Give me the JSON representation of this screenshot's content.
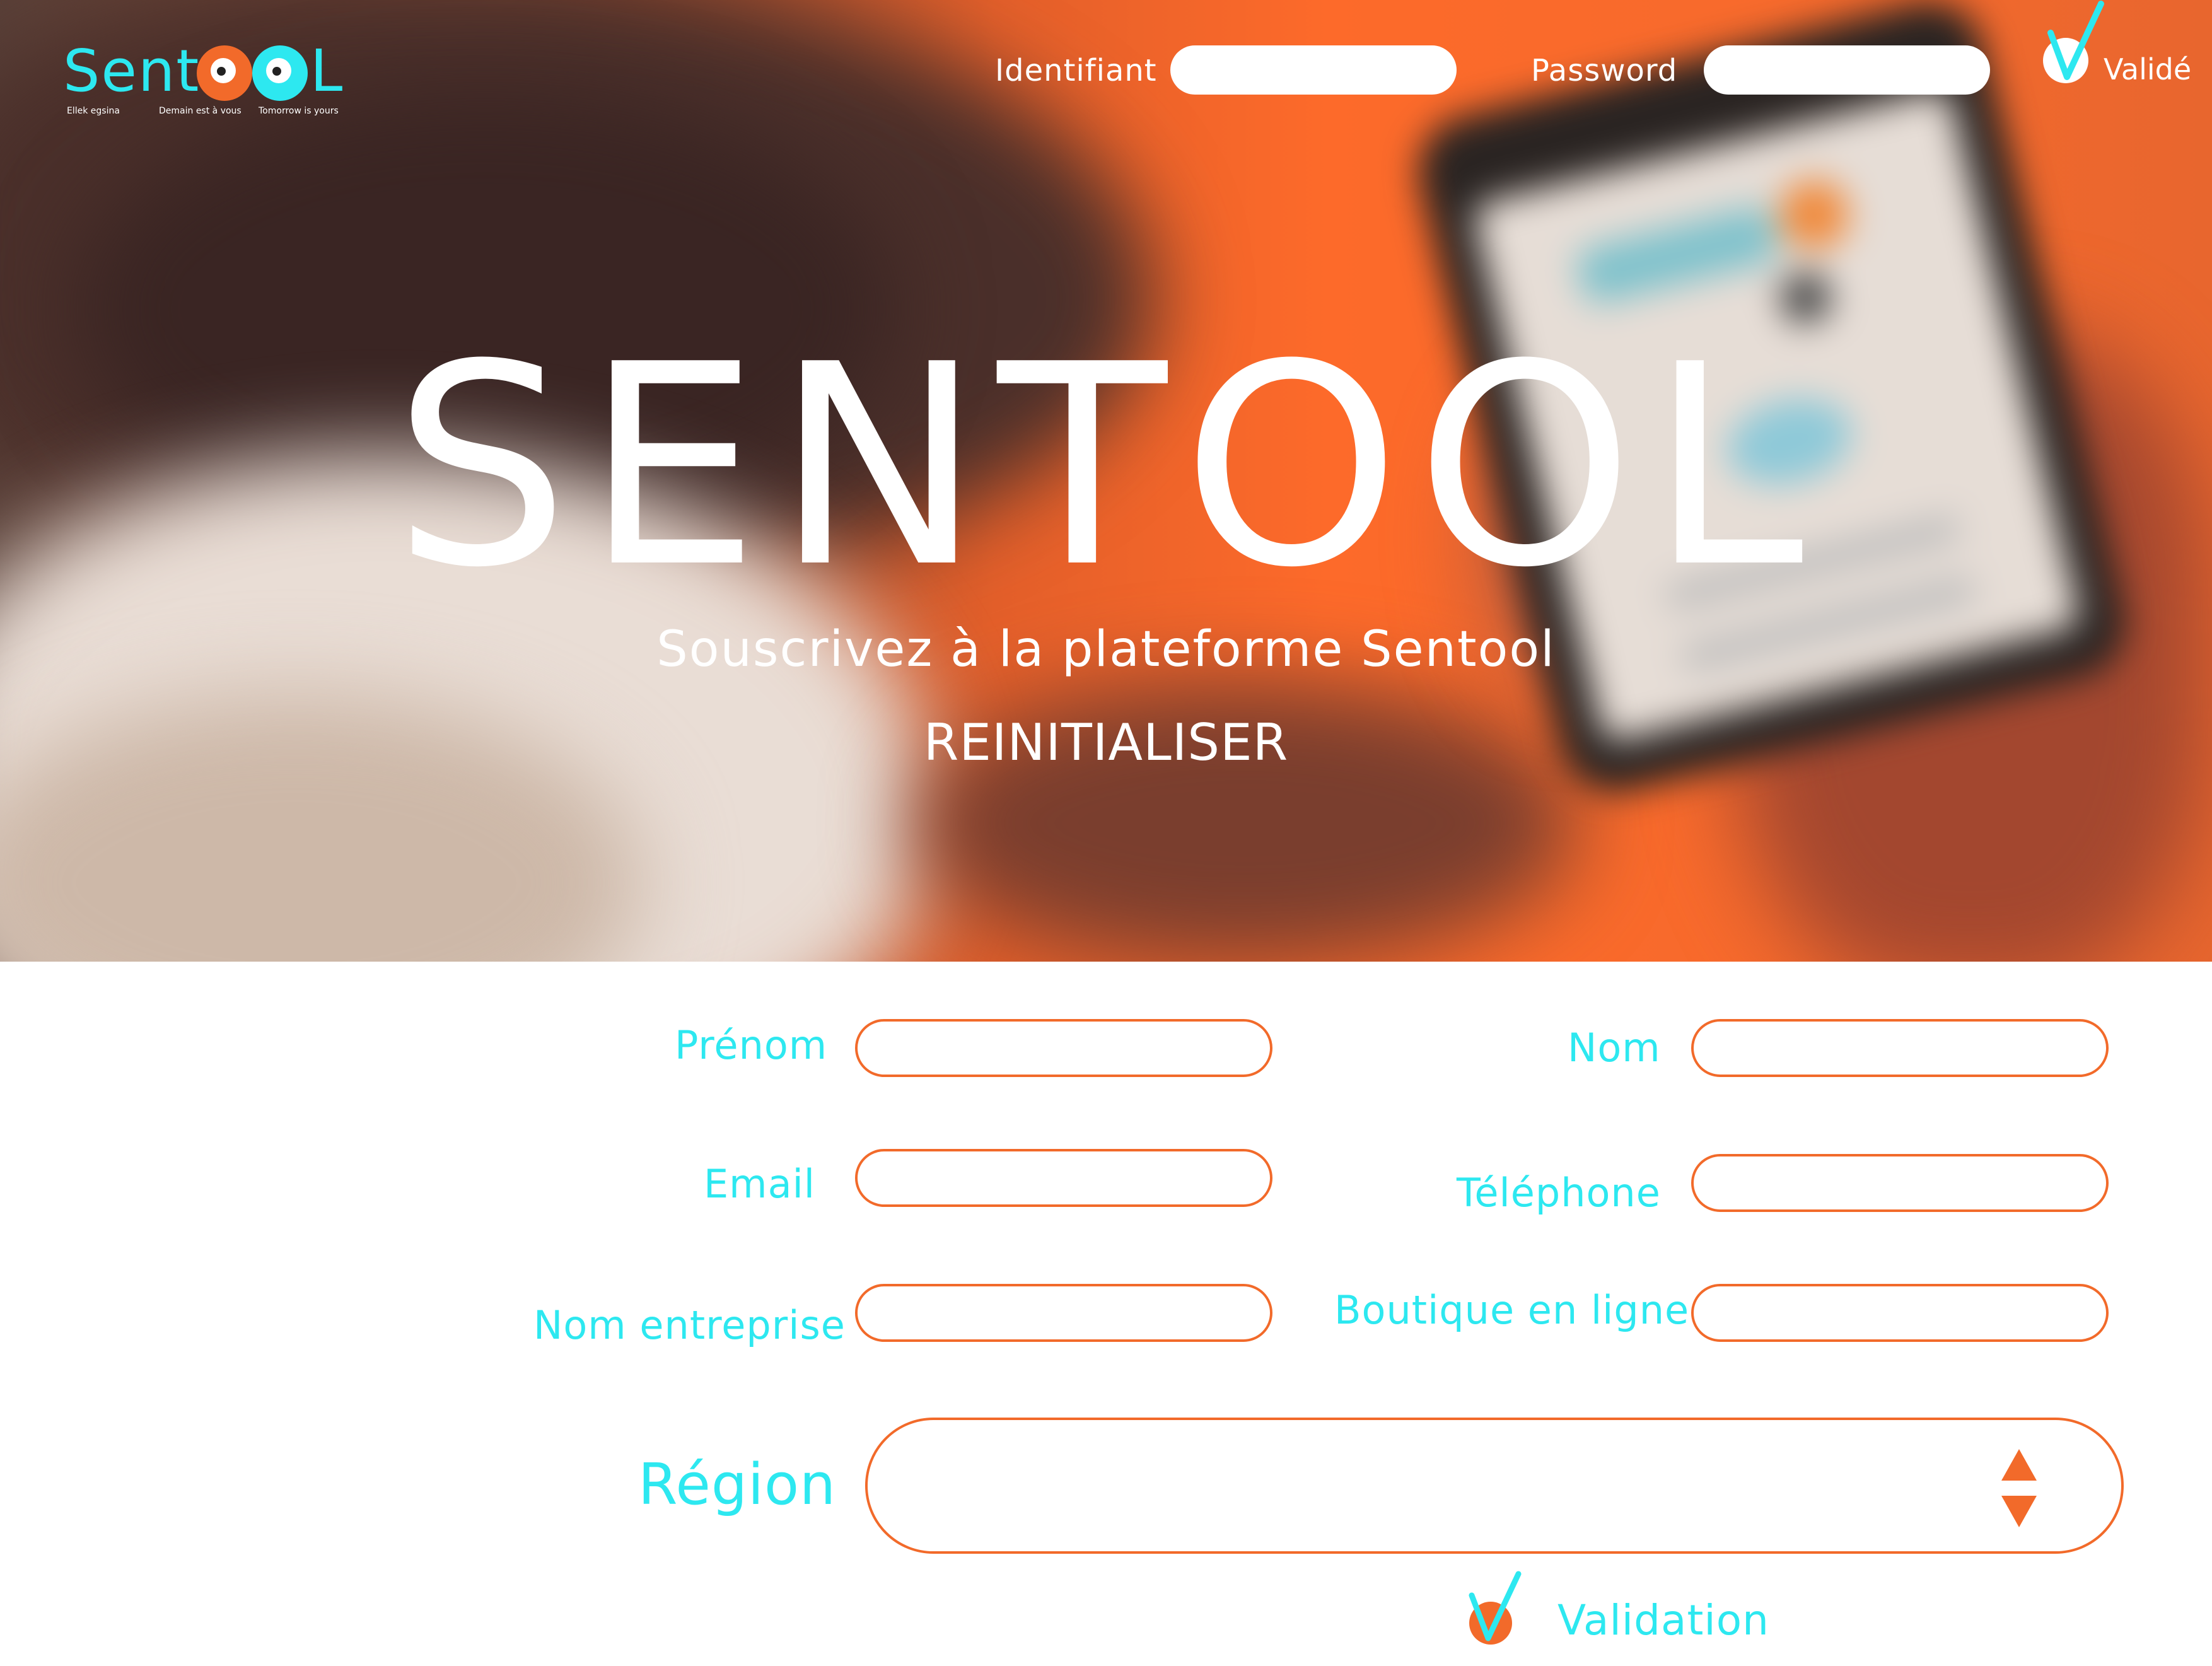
{
  "brand": {
    "logo_text_left": "Sent",
    "logo_text_right": "L",
    "tagline_1": "Ellek egsina",
    "tagline_2": "Demain est à vous",
    "tagline_3": "Tomorrow is yours"
  },
  "login": {
    "identifiant_label": "Identifiant",
    "identifiant_value": "",
    "password_label": "Password",
    "password_value": "",
    "validate_label": "Validé"
  },
  "hero": {
    "title": "SENTOOL",
    "subtitle": "Souscrivez à la plateforme Sentool",
    "reset_label": "REINITIALISER"
  },
  "form": {
    "prenom_label": "Prénom",
    "prenom_value": "",
    "nom_label": "Nom",
    "nom_value": "",
    "email_label": "Email",
    "email_value": "",
    "telephone_label": "Téléphone",
    "telephone_value": "",
    "entreprise_label": "Nom entreprise",
    "entreprise_value": "",
    "boutique_label": "Boutique en ligne",
    "boutique_value": "",
    "region_label": "Région",
    "region_value": "",
    "validation_label": "Validation"
  },
  "colors": {
    "accent_orange": "#f26a2a",
    "accent_cyan": "#2de8f0",
    "white": "#ffffff"
  },
  "icons": [
    "check-icon",
    "spinner-arrows-icon"
  ]
}
